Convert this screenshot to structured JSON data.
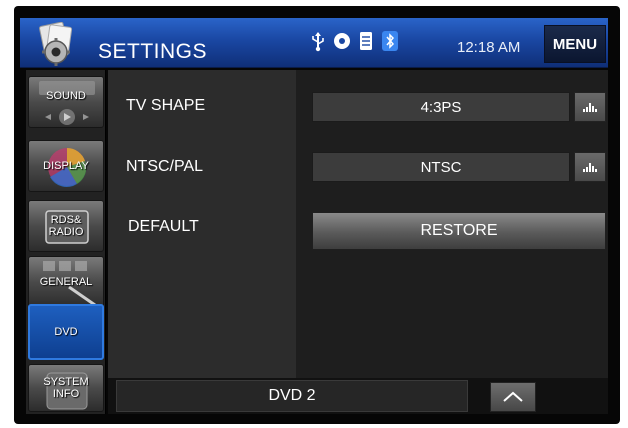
{
  "header": {
    "title": "SETTINGS",
    "clock": "12:18 AM",
    "menu_label": "MENU",
    "status_icons": [
      "usb-icon",
      "disc-icon",
      "sd-card-icon",
      "bluetooth-icon"
    ]
  },
  "sidebar": {
    "items": [
      {
        "label": "SOUND",
        "icon": "speaker-icon",
        "selected": false
      },
      {
        "label": "DISPLAY",
        "icon": "color-wheel-icon",
        "selected": false
      },
      {
        "label": "RDS&\nRADIO",
        "icon": "radio-icon",
        "selected": false
      },
      {
        "label": "GENERAL",
        "icon": "wrench-icon",
        "selected": false
      },
      {
        "label": "DVD",
        "icon": "dvd-icon",
        "selected": true
      },
      {
        "label": "SYSTEM\nINFO",
        "icon": "info-icon",
        "selected": false
      }
    ]
  },
  "settings": {
    "tv_shape": {
      "label": "TV SHAPE",
      "value": "4:3PS"
    },
    "ntsc_pal": {
      "label": "NTSC/PAL",
      "value": "NTSC"
    },
    "default": {
      "label": "DEFAULT",
      "button": "RESTORE"
    }
  },
  "bottom": {
    "source": "DVD 2"
  },
  "colors": {
    "header_blue": "#1a47a3",
    "selected_tab": "#1e5fbf",
    "panel": "#2c2c2c"
  }
}
